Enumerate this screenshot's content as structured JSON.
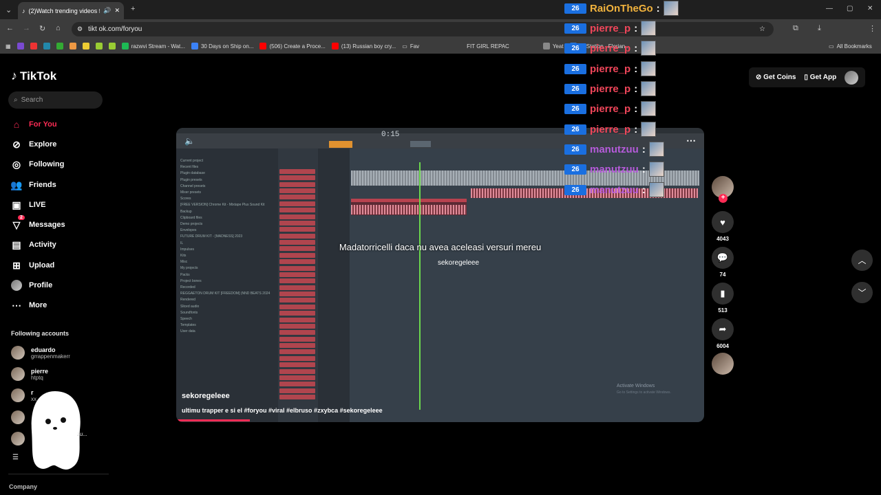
{
  "browser": {
    "tab_title": "(2)Watch trending videos fo",
    "url": "tikt ok.com/foryou",
    "bookmarks": [
      {
        "label": "razwvi Stream - Wat...",
        "color": "#1db954"
      },
      {
        "label": "30 Days on Ship on...",
        "color": "#3b82f6"
      },
      {
        "label": "(506) Create a Proce...",
        "color": "#ff0000"
      },
      {
        "label": "(13) Russian boy cry...",
        "color": "#ff0000"
      },
      {
        "label": "Fav",
        "color": "#d4a54a"
      },
      {
        "label": "FIT GIRL REPAC",
        "color": "#d4a54a"
      },
      {
        "label": "Yeat",
        "color": "#888888"
      },
      {
        "label": "ArtStation - Florian...",
        "color": "#2f7bd8"
      }
    ],
    "all_bookmarks": "All Bookmarks"
  },
  "sidebar": {
    "logo": "TikTok",
    "search_placeholder": "Search",
    "nav": [
      {
        "label": "For You",
        "icon": "home-icon",
        "active": true
      },
      {
        "label": "Explore",
        "icon": "compass-icon"
      },
      {
        "label": "Following",
        "icon": "following-icon"
      },
      {
        "label": "Friends",
        "icon": "friends-icon"
      },
      {
        "label": "LIVE",
        "icon": "live-icon"
      },
      {
        "label": "Messages",
        "icon": "messages-icon",
        "badge": "2"
      },
      {
        "label": "Activity",
        "icon": "activity-icon"
      },
      {
        "label": "Upload",
        "icon": "upload-icon"
      },
      {
        "label": "Profile",
        "icon": "profile-icon"
      },
      {
        "label": "More",
        "icon": "more-icon"
      }
    ],
    "following_title": "Following accounts",
    "accounts": [
      {
        "name": "eduardo",
        "handle": "grrappenmakerr"
      },
      {
        "name": "pierre",
        "handle": "htptq"
      },
      {
        "name": "r",
        "handle": "xx"
      }
    ],
    "company": "Company",
    "ghost_text": "zu..."
  },
  "video": {
    "caption": "Madatorricelli daca nu avea aceleasi versuri mereu",
    "sub_caption": "sekoregeleee",
    "author": "sekoregeleee",
    "description": "ultimu trapper e si el #foryou #viral #elbruso #zxybca #sekoregeleee",
    "activate": "Activate Windows",
    "activate_sub": "Go to Settings to activate Windows.",
    "progress": 0.14
  },
  "actions": {
    "likes": "4043",
    "comments": "74",
    "saves": "513",
    "shares": "6004"
  },
  "top_right": {
    "coins": "Get Coins",
    "app": "Get App"
  },
  "chat": [
    {
      "user": "RaiOnTheGo",
      "color": "#f2b33d"
    },
    {
      "user": "pierre_p",
      "color": "#f0465a"
    },
    {
      "user": "pierre_p",
      "color": "#f0465a"
    },
    {
      "user": "pierre_p",
      "color": "#f0465a"
    },
    {
      "user": "pierre_p",
      "color": "#f0465a"
    },
    {
      "user": "pierre_p",
      "color": "#f0465a"
    },
    {
      "user": "pierre_p",
      "color": "#f0465a"
    },
    {
      "user": "manutzuu",
      "color": "#b55bd9"
    },
    {
      "user": "manutzuu",
      "color": "#b55bd9"
    },
    {
      "user": "manutzuu",
      "color": "#b55bd9"
    }
  ],
  "chat_badge": "26"
}
